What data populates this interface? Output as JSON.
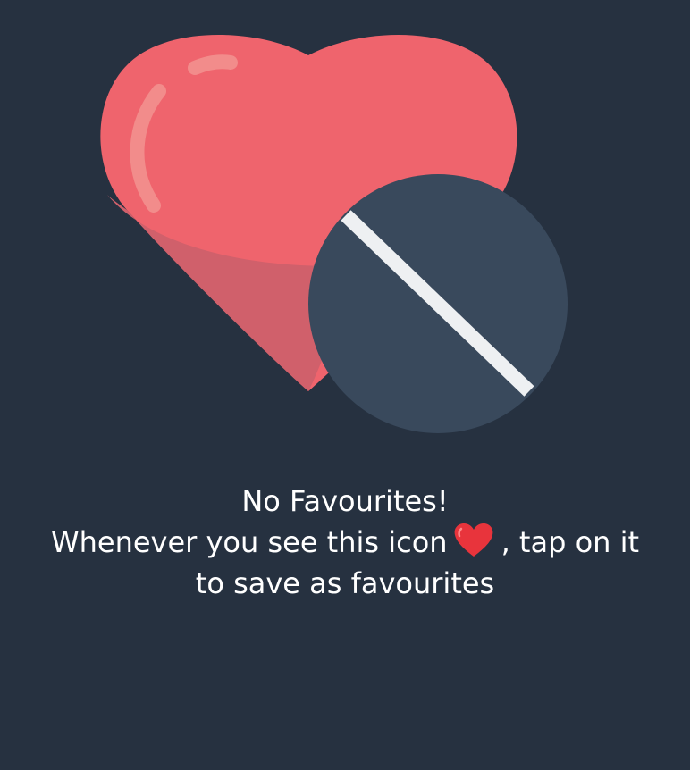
{
  "empty_state": {
    "illustration_icon": "heart-with-prohibited-icon",
    "title": "No Favourites!",
    "hint_part1": "Whenever you see this icon",
    "inline_icon": "heart-icon",
    "hint_part2": ", tap on it",
    "hint_line2": "to save as favourites"
  },
  "colors": {
    "background": "#263140",
    "heart": "#ef646d",
    "heart_shadow": "#d0606b",
    "badge": "#39495c",
    "badge_slash": "#eef0f2"
  }
}
